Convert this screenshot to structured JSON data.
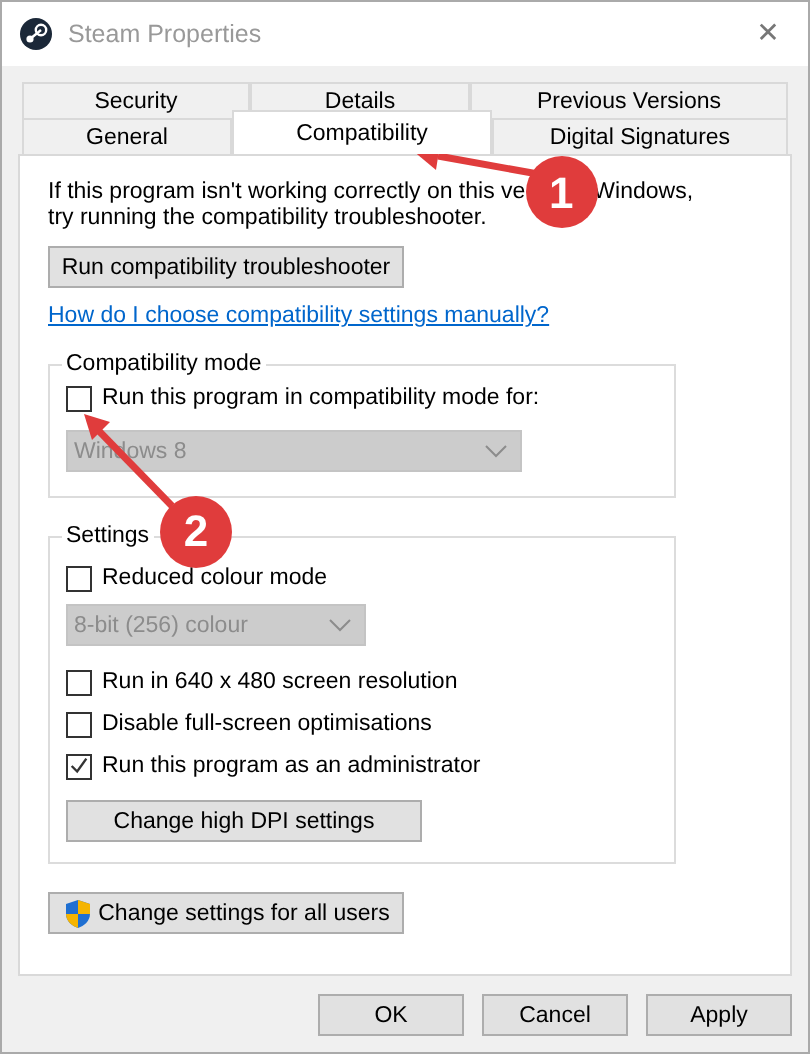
{
  "window": {
    "title": "Steam Properties",
    "close": "✕"
  },
  "tabs": [
    [
      {
        "label": "Security",
        "selected": false
      },
      {
        "label": "Details",
        "selected": false
      },
      {
        "label": "Previous Versions",
        "selected": false
      }
    ],
    [
      {
        "label": "General",
        "selected": false
      },
      {
        "label": "Compatibility",
        "selected": true
      },
      {
        "label": "Digital Signatures",
        "selected": false
      }
    ]
  ],
  "intro": {
    "line_1": [
      "If this program isn't working correctly on this ve",
      "Windows,"
    ],
    "line_2": "try running the compatibility troubleshooter."
  },
  "troubleshooter_button": "Run compatibility troubleshooter",
  "help_link": "How do I choose compatibility settings manually?",
  "compatibility_mode": {
    "label": "Compatibility mode",
    "checkbox": {
      "label": "Run this program in compatibility mode for:",
      "checked": false
    },
    "dropdown": {
      "value": "Windows 8",
      "disabled": true
    }
  },
  "settings": {
    "label": "Settings",
    "items": [
      {
        "kind": "checkbox",
        "label": "Reduced colour mode",
        "checked": false
      },
      {
        "kind": "dropdown",
        "value": "8-bit (256) colour",
        "disabled": true
      },
      {
        "kind": "checkbox",
        "label": "Run in 640 x 480 screen resolution",
        "checked": false
      },
      {
        "kind": "checkbox",
        "label": "Disable full-screen optimisations",
        "checked": false
      },
      {
        "kind": "checkbox",
        "label": "Run this program as an administrator",
        "checked": true
      },
      {
        "kind": "button",
        "label": "Change high DPI settings"
      }
    ]
  },
  "all_users_button": "Change settings for all users",
  "buttons": [
    "OK",
    "Cancel",
    "Apply"
  ],
  "annotations": [
    {
      "number": "1"
    },
    {
      "number": "2"
    }
  ]
}
